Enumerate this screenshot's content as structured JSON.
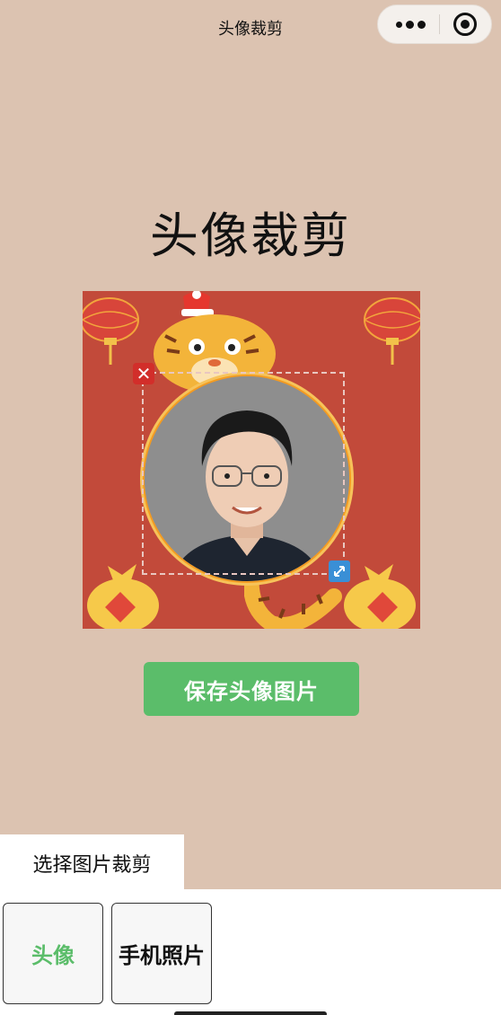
{
  "nav": {
    "title": "头像裁剪",
    "more_icon": "more-dots-icon",
    "close_icon": "target-circle-icon"
  },
  "heading": "头像裁剪",
  "editor": {
    "frame_theme": "tiger-new-year",
    "close_icon": "close-icon",
    "resize_icon": "resize-icon",
    "colors": {
      "background": "#c24a3a",
      "ring": "#f39b22",
      "close": "#d22e2a",
      "resize": "#3a8fd6"
    }
  },
  "save_button": {
    "label": "保存头像图片",
    "color": "#5bbd6a"
  },
  "panel": {
    "title": "选择图片裁剪",
    "options": [
      {
        "label": "头像",
        "active": true
      },
      {
        "label": "手机照片",
        "active": false
      }
    ]
  },
  "colors": {
    "page_bg": "#dcc3b1",
    "accent": "#5bbd6a"
  }
}
